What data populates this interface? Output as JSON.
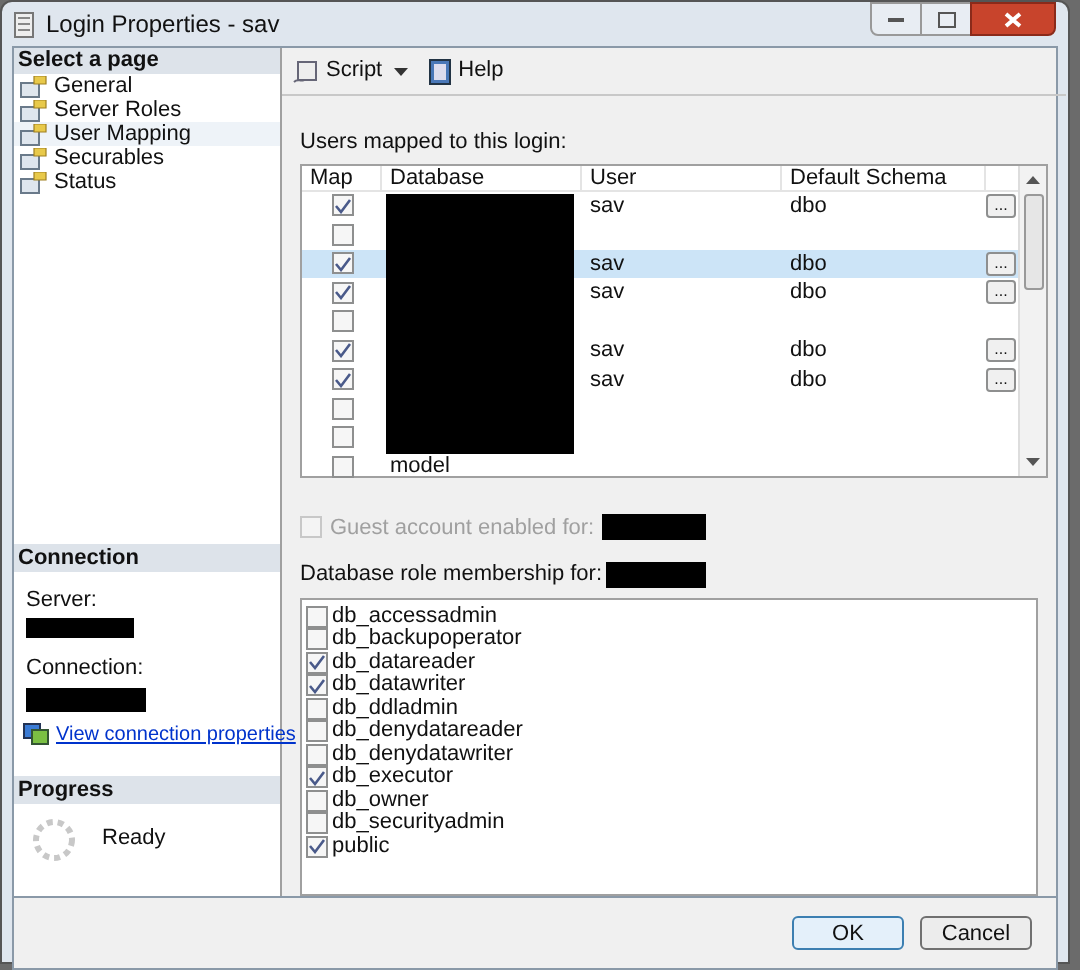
{
  "window": {
    "title": "Login Properties - sav"
  },
  "sidebar": {
    "header": "Select a page",
    "items": [
      {
        "label": "General",
        "selected": false
      },
      {
        "label": "Server Roles",
        "selected": false
      },
      {
        "label": "User Mapping",
        "selected": true
      },
      {
        "label": "Securables",
        "selected": false
      },
      {
        "label": "Status",
        "selected": false
      }
    ]
  },
  "connection": {
    "header": "Connection",
    "server_label": "Server:",
    "connection_label": "Connection:",
    "link": "View connection properties"
  },
  "progress": {
    "header": "Progress",
    "status": "Ready"
  },
  "toolbar": {
    "script": "Script",
    "help": "Help"
  },
  "users_mapped": {
    "label": "Users mapped to this login:",
    "columns": [
      "Map",
      "Database",
      "User",
      "Default Schema"
    ],
    "rows": [
      {
        "checked": true,
        "selected": false,
        "user": "sav",
        "schema": "dbo",
        "button": "..."
      },
      {
        "checked": false,
        "selected": false
      },
      {
        "checked": true,
        "selected": true,
        "user": "sav",
        "schema": "dbo",
        "button": "..."
      },
      {
        "checked": true,
        "selected": false,
        "user": "sav",
        "schema": "dbo",
        "button": "..."
      },
      {
        "checked": false,
        "selected": false
      },
      {
        "checked": true,
        "selected": false,
        "user": "sav",
        "schema": "dbo",
        "button": "..."
      },
      {
        "checked": true,
        "selected": false,
        "user": "sav",
        "schema": "dbo",
        "button": "..."
      },
      {
        "checked": false,
        "selected": false
      },
      {
        "checked": false,
        "selected": false
      },
      {
        "checked": false,
        "selected": false,
        "database": "model"
      }
    ]
  },
  "guest": {
    "label": "Guest account enabled for:",
    "checked": false,
    "disabled": true
  },
  "roles": {
    "label": "Database role membership for:",
    "items": [
      {
        "label": "db_accessadmin",
        "checked": false
      },
      {
        "label": "db_backupoperator",
        "checked": false
      },
      {
        "label": "db_datareader",
        "checked": true
      },
      {
        "label": "db_datawriter",
        "checked": true
      },
      {
        "label": "db_ddladmin",
        "checked": false
      },
      {
        "label": "db_denydatareader",
        "checked": false
      },
      {
        "label": "db_denydatawriter",
        "checked": false
      },
      {
        "label": "db_executor",
        "checked": true
      },
      {
        "label": "db_owner",
        "checked": false
      },
      {
        "label": "db_securityadmin",
        "checked": false
      },
      {
        "label": "public",
        "checked": true
      }
    ]
  },
  "buttons": [
    "OK",
    "Cancel"
  ]
}
